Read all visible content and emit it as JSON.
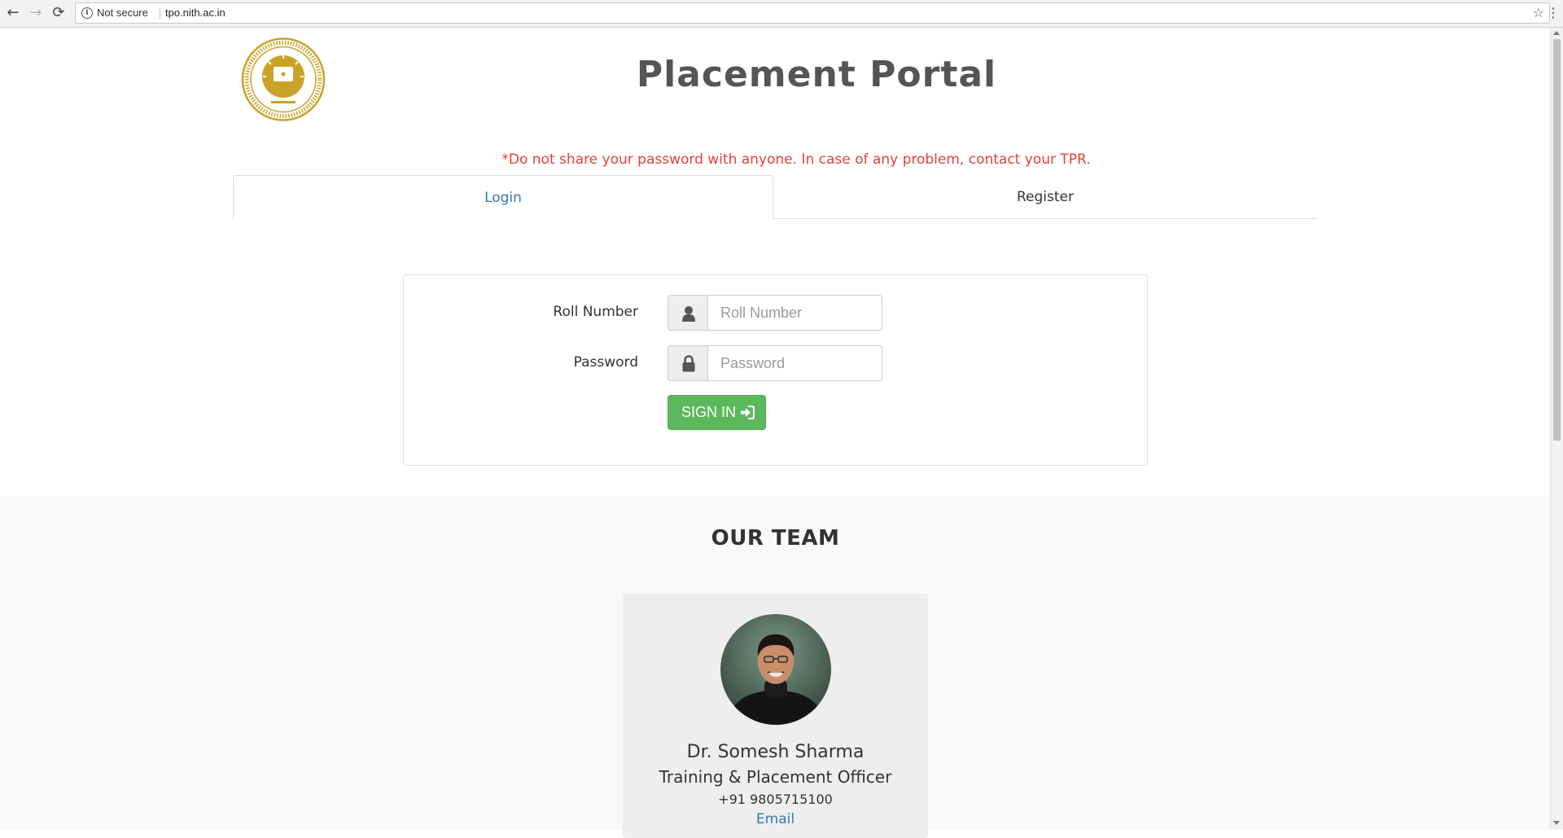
{
  "browser": {
    "security_label": "Not secure",
    "url": "tpo.nith.ac.in",
    "back_icon": "arrow-left-icon",
    "forward_icon": "arrow-right-icon",
    "reload_icon": "reload-icon",
    "bookmark_icon": "star-icon",
    "menu_icon": "vertical-dots-icon"
  },
  "header": {
    "title": "Placement Portal",
    "logo": "institute-seal-logo"
  },
  "notice": {
    "text": "*Do not share your password with anyone. In case of any problem, contact your TPR."
  },
  "tabs": [
    {
      "label": "Login",
      "active": true
    },
    {
      "label": "Register",
      "active": false
    }
  ],
  "login_form": {
    "roll_label": "Roll Number",
    "roll_placeholder": "Roll Number",
    "roll_icon": "user-icon",
    "password_label": "Password",
    "password_placeholder": "Password",
    "password_icon": "lock-icon",
    "signin_label": "SIGN IN",
    "signin_icon": "sign-in-icon"
  },
  "team": {
    "title": "OUR TEAM",
    "members": [
      {
        "name": "Dr. Somesh Sharma",
        "role": "Training & Placement Officer",
        "phone": "+91 9805715100",
        "email_link": "Email"
      }
    ]
  },
  "colors": {
    "accent_link": "#337ab7",
    "warning": "#e3403a",
    "signin_button": "#5cb85c",
    "logo_gold": "#c9a227"
  }
}
